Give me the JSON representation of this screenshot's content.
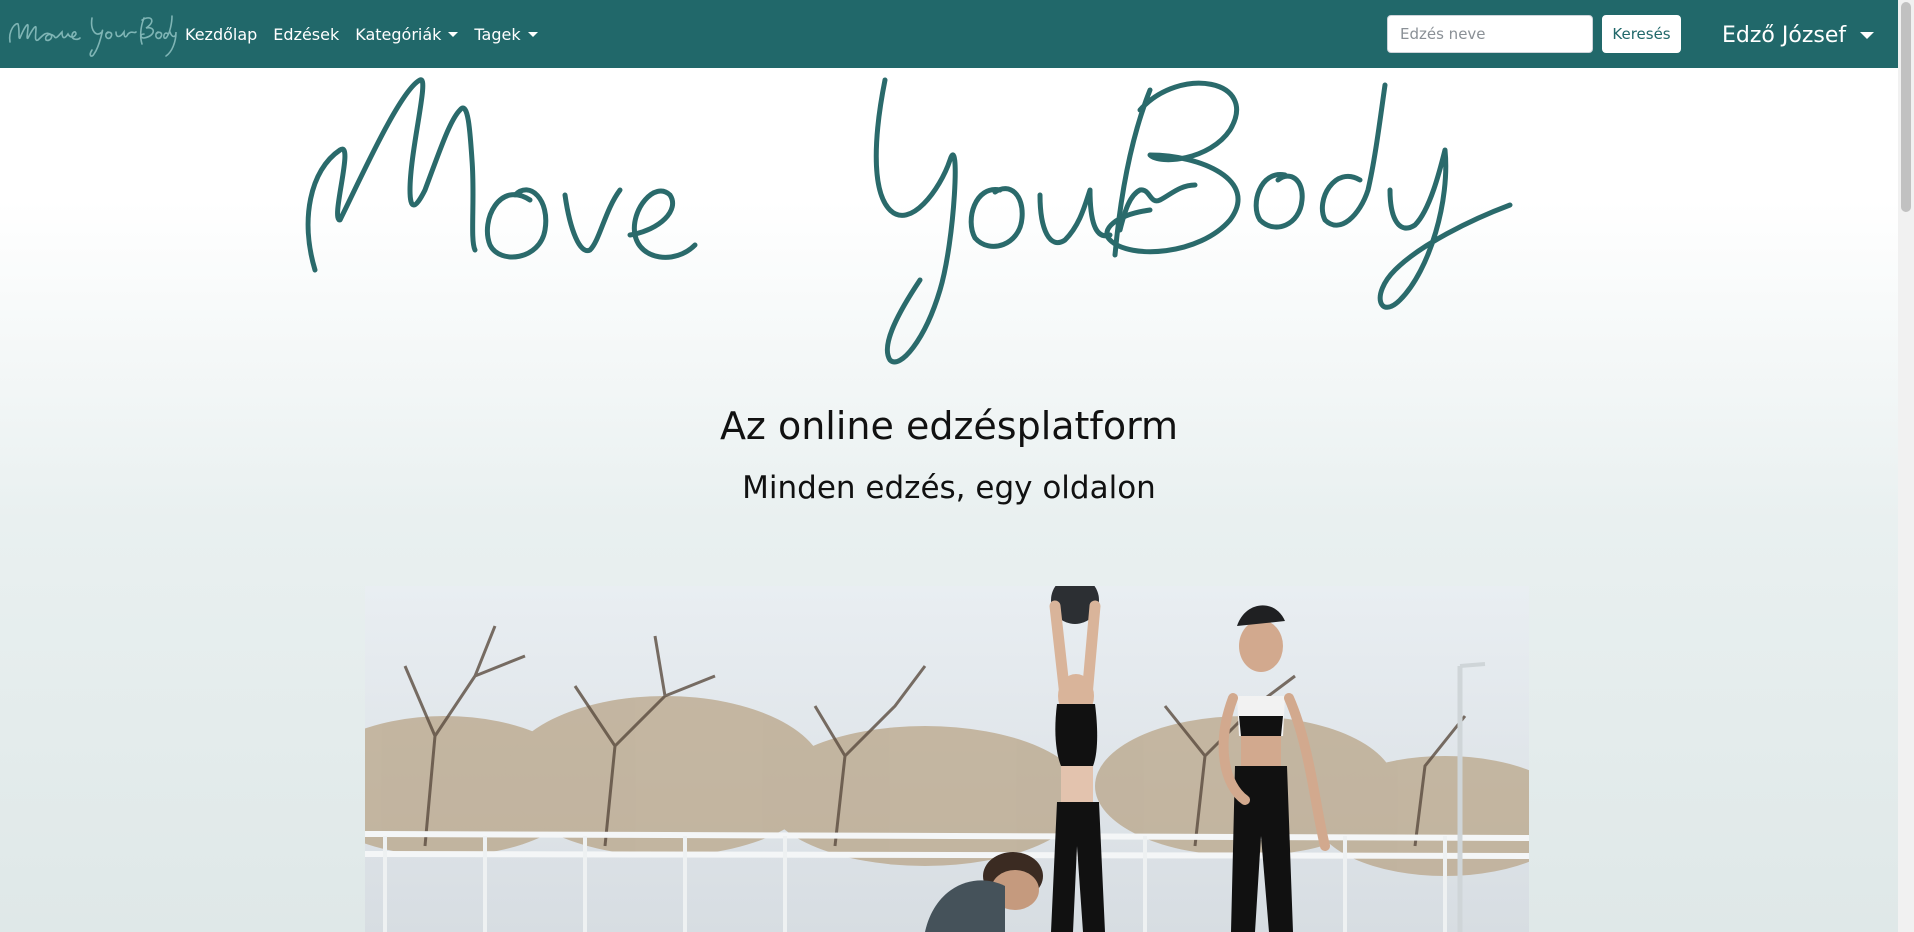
{
  "navbar": {
    "brand_text": "Move Your Body",
    "links": [
      {
        "label": "Kezdőlap",
        "has_dropdown": false
      },
      {
        "label": "Edzések",
        "has_dropdown": false
      },
      {
        "label": "Kategóriák",
        "has_dropdown": true
      },
      {
        "label": "Tagek",
        "has_dropdown": true
      }
    ],
    "search": {
      "placeholder": "Edzés neve",
      "value": "",
      "button_label": "Keresés"
    },
    "user": {
      "name": "Edző József",
      "has_dropdown": true
    }
  },
  "hero": {
    "logo_text": "Move Your Body",
    "title": "Az online edzésplatform",
    "subtitle": "Minden edzés, egy oldalon"
  },
  "colors": {
    "brand": "#21686a",
    "navbar_text": "#ffffff"
  }
}
